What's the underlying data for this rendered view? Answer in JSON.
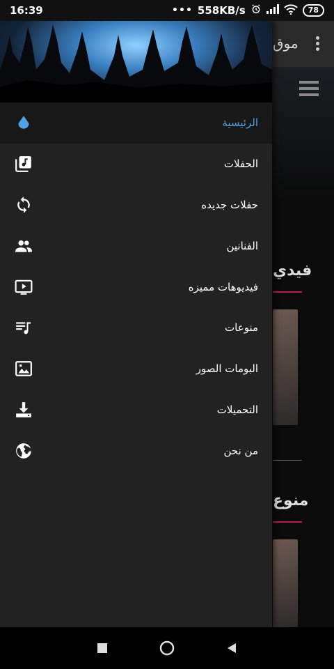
{
  "status_bar": {
    "time": "16:39",
    "dots": "•••",
    "network_speed": "558KB/s",
    "battery": "78",
    "icons": [
      "alarm-icon",
      "signal-icon",
      "wifi-icon",
      "battery-icon"
    ]
  },
  "app": {
    "title_fragment": "موق",
    "section_videos": "فيدي",
    "section_misc": "منوع"
  },
  "drawer": {
    "menu": [
      {
        "label": "الرئيسية",
        "icon": "home-drop-icon",
        "active": true
      },
      {
        "label": "الحفلات",
        "icon": "music-library-icon"
      },
      {
        "label": "حفلات جديده",
        "icon": "sync-icon"
      },
      {
        "label": "الفنانين",
        "icon": "people-icon"
      },
      {
        "label": "فيديوهات مميزه",
        "icon": "tv-play-icon"
      },
      {
        "label": "منوعات",
        "icon": "playlist-icon"
      },
      {
        "label": "البومات الصور",
        "icon": "image-icon"
      },
      {
        "label": "التحميلات",
        "icon": "download-icon"
      },
      {
        "label": "من نحن",
        "icon": "globe-icon"
      }
    ]
  },
  "colors": {
    "drawer_bg": "#222222",
    "active_accent": "#4ea3e6",
    "section_accent": "#c2185b"
  }
}
